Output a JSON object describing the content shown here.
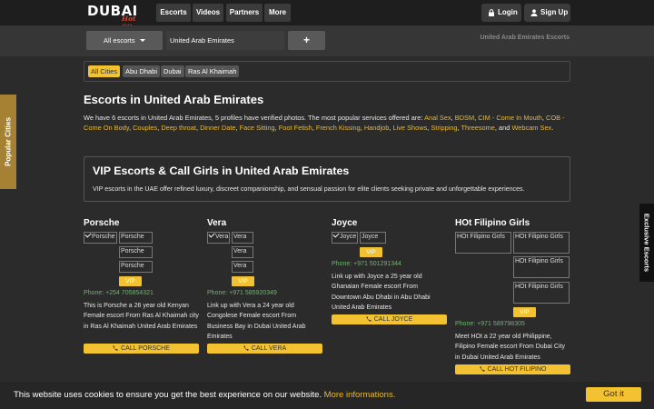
{
  "logo": {
    "word": "DUBAI",
    "tag": "Hot Site"
  },
  "nav": [
    "Escorts",
    "Videos",
    "Partners",
    "More"
  ],
  "auth": {
    "login": "Login",
    "signup": "Sign Up"
  },
  "search": {
    "select": "All escorts",
    "location": "United Arab Emirates",
    "add": "+"
  },
  "breadcrumb": "United Arab Emirates Escorts",
  "cities": [
    "All Cities",
    "Abu Dhabi",
    "Dubai",
    "Ras Al Khaimah"
  ],
  "page_title": "Escorts in United Arab Emirates",
  "intro": {
    "lead": "We have 6 escorts in United Arab Emirates, 5 profiles have verified photos. The most popular services offered are: ",
    "services": [
      "Anal Sex",
      "BDSM",
      "CIM - Come In Mouth",
      "COB - Come On Body",
      "Couples",
      "Deep throat",
      "Dinner Date",
      "Face Sitting",
      "Foot Fetish",
      "French Kissing",
      "Handjob",
      "Live Shows",
      "Stripping",
      "Threesome",
      "Webcam Sex"
    ],
    "and": "and"
  },
  "vip": {
    "title": "VIP Escorts & Call Girls in United Arab Emirates",
    "text": "VIP escorts in the UAE offer refined luxury, discreet companionship, and sensual passion for elite clients seeking private and unforgettable experiences."
  },
  "cards": [
    {
      "name": "Porsche",
      "photos": [
        "Porsche",
        "Porsche",
        "Porsche",
        "Porsche"
      ],
      "badge": "VIP",
      "phone": "Phone: +254 705854321",
      "desc": "This is Porsche a 26 year old Kenyan Female escort From Ras Al Khaimah city in Ras Al Khaimah United Arab Emirates",
      "call": "CALL PORSCHE"
    },
    {
      "name": "Vera",
      "photos": [
        "Vera",
        "Vera",
        "Vera",
        "Vera"
      ],
      "badge": "VIP",
      "phone": "Phone: +971 585920349",
      "desc": "Link up with Vera a 24 year old Congolese Female escort From Business Bay in Dubai United Arab Emirates",
      "call": "CALL VERA"
    },
    {
      "name": "Joyce",
      "photos": [
        "Joyce",
        "Joyce"
      ],
      "badge": "VIP",
      "phone": "Phone: +971 501291344",
      "desc": "Link up with Joyce a 25 year old Ghanaian Female escort From Downtown Abu Dhabi in Abu Dhabi United Arab Emirates",
      "call": "CALL JOYCE"
    },
    {
      "name": "HOt Filipino Girls",
      "photos": [
        "HOt Filipino Girls",
        "HOt Filipino Girls",
        "HOt Filipino Girls",
        "HOt Filipino Girls"
      ],
      "badge": "VIP",
      "phone": "Phone: +971 589798305",
      "desc": "Meet HOt a 22 year old Philippine, Filipino Female escort From Dubai City in Dubai United Arab Emirates",
      "call": "CALL HOT FILIPINO"
    }
  ],
  "side_left": "Popular Cities",
  "side_right": "Exclusive Escorts",
  "cookie": {
    "text": "This website uses cookies to ensure you get the best experience on our website.",
    "link": "More informations.",
    "button": "Got it"
  },
  "colors": {
    "accent": "#f2c230",
    "phone": "#6db36d",
    "link": "#e7b934",
    "side_tab": "#a58134"
  }
}
